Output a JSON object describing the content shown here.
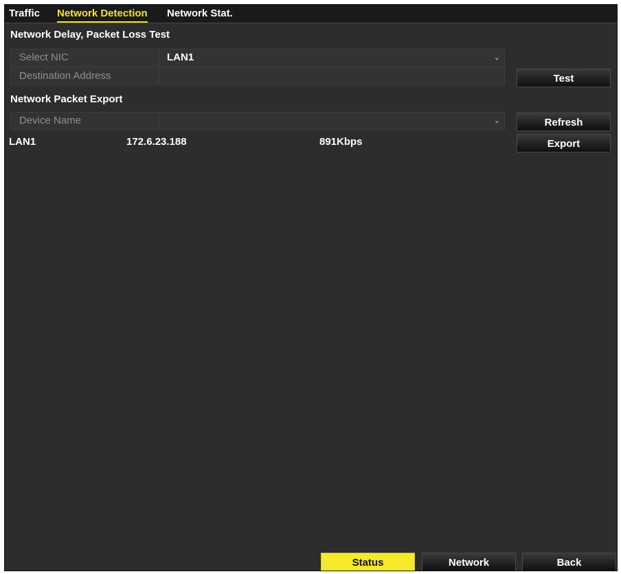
{
  "tabs": [
    "Traffic",
    "Network Detection",
    "Network Stat."
  ],
  "active_tab": 1,
  "delay_test": {
    "title": "Network Delay, Packet Loss Test",
    "nic_label": "Select NIC",
    "nic_value": "LAN1",
    "dest_label": "Destination Address",
    "dest_value": "",
    "test_button": "Test"
  },
  "packet_export": {
    "title": "Network Packet Export",
    "device_label": "Device Name",
    "device_value": "",
    "refresh_button": "Refresh",
    "export_button": "Export",
    "row": {
      "name": "LAN1",
      "ip": "172.6.23.188",
      "rate": "891Kbps"
    }
  },
  "footer": {
    "status": "Status",
    "network": "Network",
    "back": "Back"
  },
  "colors": {
    "accent": "#f0e42c",
    "background": "#2d2d2d",
    "button_active": "#f5e92a"
  },
  "icons": {
    "dropdown": "chevron-down-icon"
  }
}
